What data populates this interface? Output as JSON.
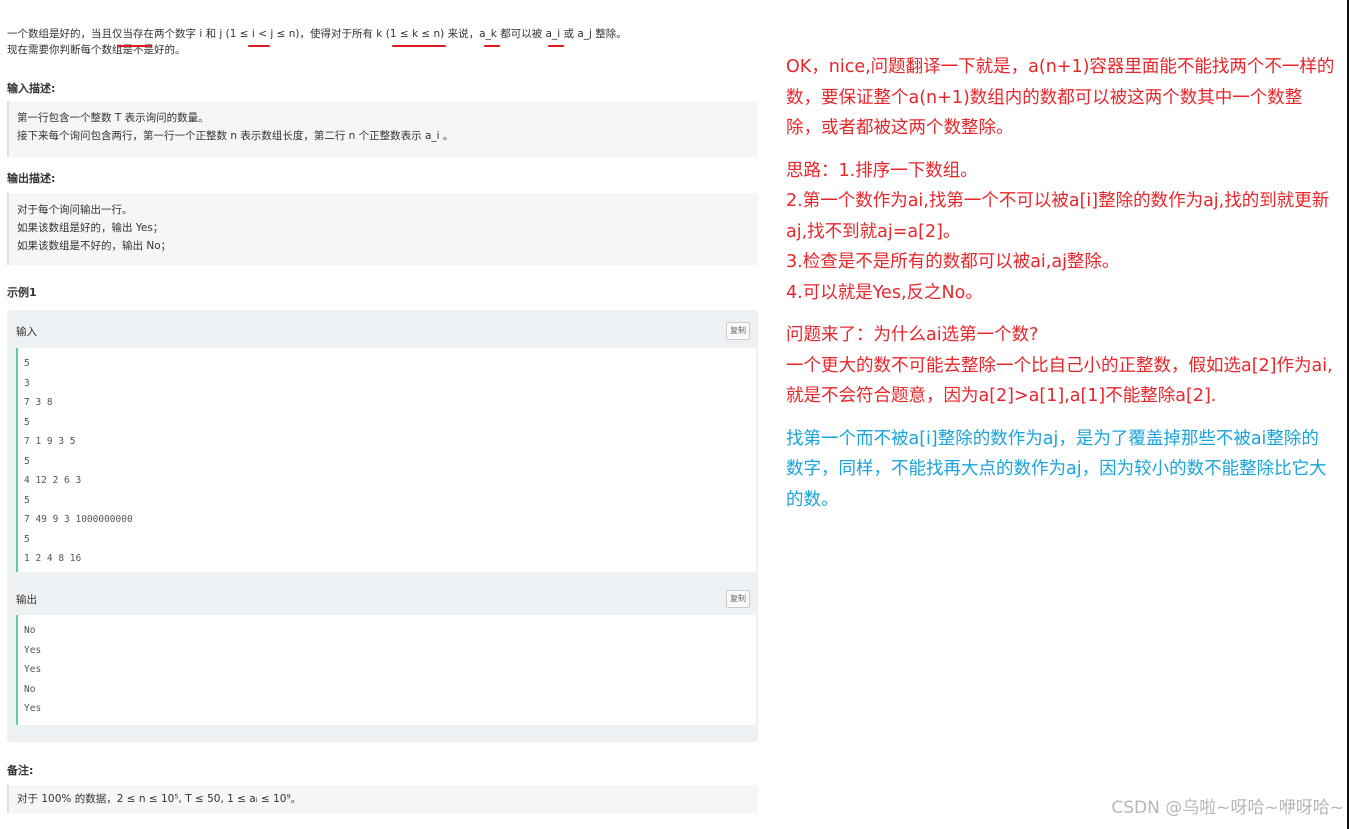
{
  "problem": {
    "statement_line1": "一个数组是好的，当且仅当存在两个数字 i 和 j (1 ≤ i < j ≤ n)，使得对于所有 k (1 ≤ k ≤ n) 来说，a_k 都可以被 a_i 或 a_j 整除。",
    "statement_line2": "现在需要你判断每个数组是不是好的。",
    "input_title": "输入描述:",
    "input_lines": [
      "第一行包含一个整数 T 表示询问的数量。",
      "接下来每个询问包含两行，第一行一个正整数 n 表示数组长度，第二行 n 个正整数表示 a_i 。"
    ],
    "output_title": "输出描述:",
    "output_lines": [
      "对于每个询问输出一行。",
      "如果该数组是好的，输出 Yes；",
      "如果该数组是不好的，输出 No；"
    ],
    "example_title": "示例1",
    "example_input_label": "输入",
    "example_output_label": "输出",
    "copy_label": "复制",
    "input_sample": [
      "5",
      "3",
      "7 3 8",
      "5",
      "7 1 9 3 5",
      "5",
      "4 12 2 6 3",
      "5",
      "7 49 9 3 1000000000",
      "5",
      "1 2 4 8 16"
    ],
    "output_sample": [
      "No",
      "Yes",
      "Yes",
      "No",
      "Yes"
    ],
    "note_title": "备注:",
    "note_text": "对于 100% 的数据，2 ≤ n ≤ 10⁵, T ≤ 50, 1 ≤ aᵢ ≤ 10⁹。"
  },
  "notes": {
    "p1": "OK，nice,问题翻译一下就是，a(n+1)容器里面能不能找两个不一样的数，要保证整个a(n+1)数组内的数都可以被这两个数其中一个数整除，或者都被这两个数整除。",
    "p2_lines": [
      "思路：1.排序一下数组。",
      "2.第一个数作为ai,找第一个不可以被a[i]整除的数作为aj,找的到就更新aj,找不到就aj=a[2]。",
      "3.检查是不是所有的数都可以被ai,aj整除。",
      "4.可以就是Yes,反之No。"
    ],
    "p3_lines": [
      "问题来了：为什么ai选第一个数?",
      "一个更大的数不可能去整除一个比自己小的正整数，假如选a[2]作为ai,就是不会符合题意，因为a[2]>a[1],a[1]不能整除a[2]."
    ],
    "p4": "找第一个而不被a[i]整除的数作为aj，是为了覆盖掉那些不被ai整除的数字，同样，不能找再大点的数作为aj，因为较小的数不能整除比它大的数。",
    "red_color": "#e8262a",
    "blue_color": "#19a3da"
  },
  "watermark": "CSDN @乌啦~呀哈~咿呀哈~"
}
